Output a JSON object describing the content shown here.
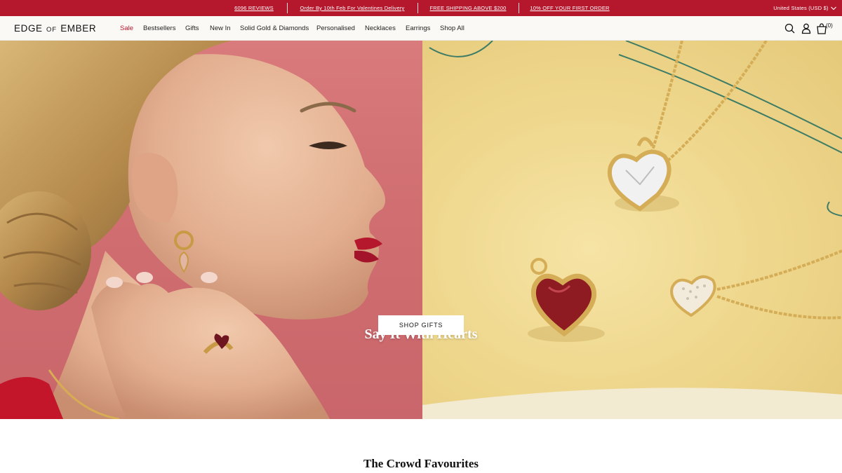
{
  "announcement": {
    "messages": [
      "6096 REVIEWS",
      "Order By 10th Feb For Valentines Delivery",
      "FREE SHIPPING ABOVE $200",
      "10% OFF YOUR FIRST ORDER"
    ],
    "region": "United States (USD $)"
  },
  "header": {
    "logo": {
      "part1": "EDGE",
      "part2": "OF",
      "part3": "EMBER"
    },
    "nav": [
      "Sale",
      "Bestsellers",
      "Gifts",
      "New In",
      "Solid Gold & Diamonds",
      "Personalised",
      "Necklaces",
      "Earrings",
      "Shop All"
    ],
    "icons": [
      "search-icon",
      "account-icon",
      "cart-icon"
    ],
    "cart_count": "(0)"
  },
  "hero": {
    "title": "Say It With Hearts",
    "cta": "SHOP GIFTS",
    "left_image": "woman-profile-wearing-gold-earring-and-heart-ring",
    "right_image": "gold-heart-pendant-necklaces-on-yellow-paper"
  },
  "section": {
    "title": "The Crowd Favourites"
  },
  "colors": {
    "announcement_bg": "#b5172d",
    "sale_text": "#b5172d",
    "header_bg": "#faf9f6",
    "hero_left_bg": "#d06e71",
    "hero_right_bg": "#efd88e"
  }
}
